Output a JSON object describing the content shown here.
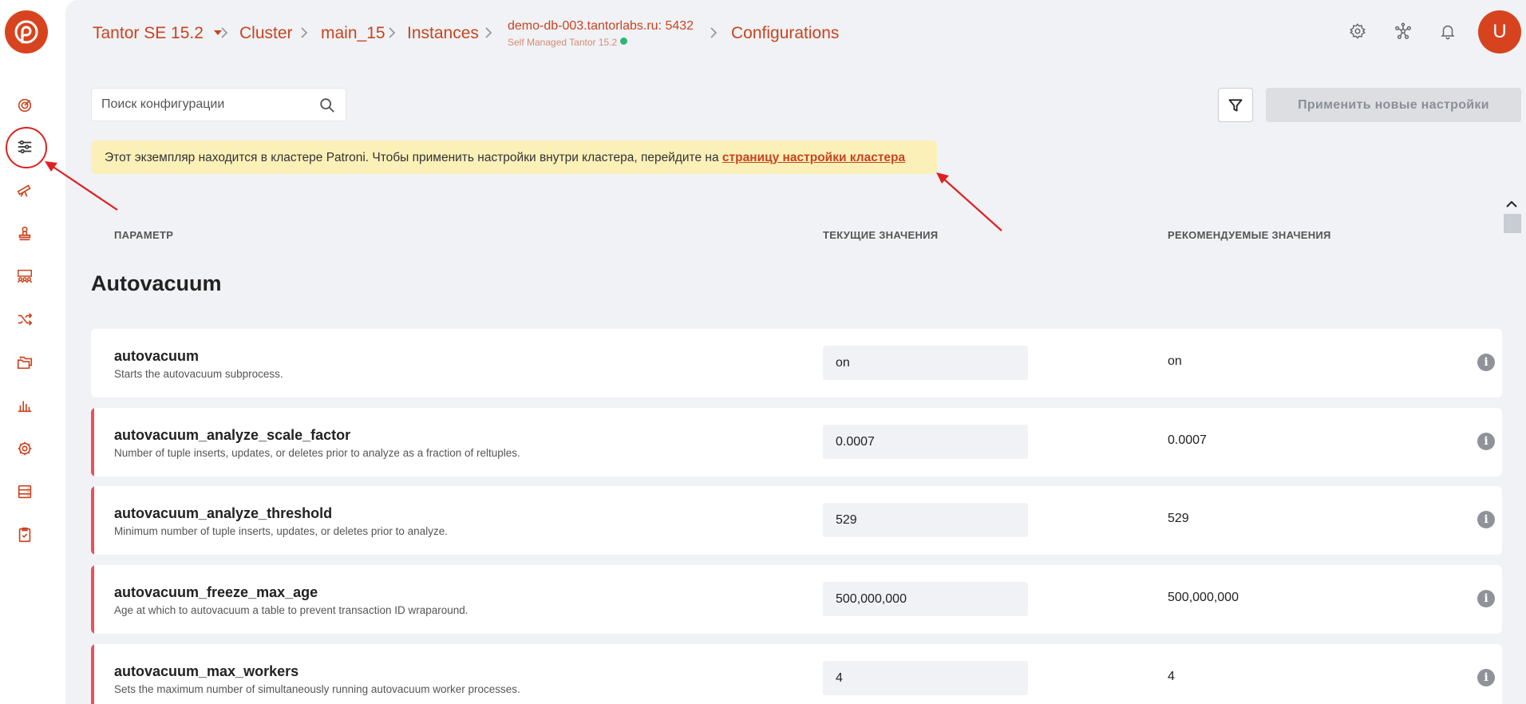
{
  "header": {
    "breadcrumbs": [
      "Tantor SE 15.2",
      "Cluster",
      "main_15",
      "Instances",
      "Configurations"
    ],
    "instance_host": "demo-db-003.tantorlabs.ru: 5432",
    "instance_sub": "Self Managed Tantor 15.2",
    "avatar_letter": "U"
  },
  "sidebar": {
    "items": [
      "dashboard-icon",
      "settings-sliders-icon",
      "telescope-icon",
      "stamp-icon",
      "users-group-icon",
      "shuffle-icon",
      "folders-icon",
      "bar-chart-icon",
      "gear-icon",
      "database-icon",
      "checklist-icon"
    ],
    "active": "settings-sliders-icon"
  },
  "toolbar": {
    "search_placeholder": "Поиск конфигурации",
    "apply_label": "Применить новые настройки"
  },
  "banner": {
    "text": "Этот экземпляр находится в кластере Patroni. Чтобы применить настройки внутри кластера, перейдите на ",
    "link": "страницу настройки кластера"
  },
  "table": {
    "headers": [
      "ПАРАМЕТР",
      "ТЕКУЩИЕ ЗНАЧЕНИЯ",
      "РЕКОМЕНДУЕМЫЕ ЗНАЧЕНИЯ"
    ],
    "section": "Autovacuum",
    "rows": [
      {
        "name": "autovacuum",
        "desc": "Starts the autovacuum subprocess.",
        "current": "on",
        "recommended": "on",
        "modified": false
      },
      {
        "name": "autovacuum_analyze_scale_factor",
        "desc": "Number of tuple inserts, updates, or deletes prior to analyze as a fraction of reltuples.",
        "current": "0.0007",
        "recommended": "0.0007",
        "modified": true
      },
      {
        "name": "autovacuum_analyze_threshold",
        "desc": "Minimum number of tuple inserts, updates, or deletes prior to analyze.",
        "current": "529",
        "recommended": "529",
        "modified": true
      },
      {
        "name": "autovacuum_freeze_max_age",
        "desc": "Age at which to autovacuum a table to prevent transaction ID wraparound.",
        "current": "500,000,000",
        "recommended": "500,000,000",
        "modified": true
      },
      {
        "name": "autovacuum_max_workers",
        "desc": "Sets the maximum number of simultaneously running autovacuum worker processes.",
        "current": "4",
        "recommended": "4",
        "modified": true
      }
    ]
  },
  "colors": {
    "accent": "#c9441e",
    "brand": "#d8431f",
    "banner_bg": "#fbf0b8",
    "modified_marker": "#ef4f5a",
    "annotation": "#e02020"
  }
}
